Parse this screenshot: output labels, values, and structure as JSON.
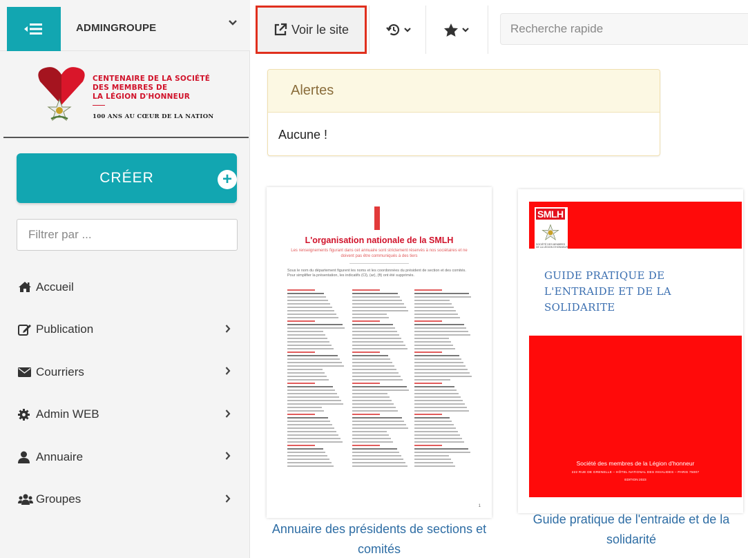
{
  "sidebar": {
    "group_name": "ADMINGROUPE",
    "logo": {
      "line1": "CENTENAIRE DE LA SOCIÉTÉ",
      "line2": "DES MEMBRES DE",
      "line3": "LA LÉGION D'HONNEUR",
      "tagline": "100 ANS AU CŒUR DE LA NATION"
    },
    "create_label": "CRÉER",
    "filter_placeholder": "Filtrer par ...",
    "items": [
      {
        "label": "Accueil",
        "icon": "home-icon",
        "has_submenu": false
      },
      {
        "label": "Publication",
        "icon": "edit-icon",
        "has_submenu": true
      },
      {
        "label": "Courriers",
        "icon": "envelope-icon",
        "has_submenu": true
      },
      {
        "label": "Admin WEB",
        "icon": "cog-icon",
        "has_submenu": true
      },
      {
        "label": "Annuaire",
        "icon": "user-icon",
        "has_submenu": true
      },
      {
        "label": "Groupes",
        "icon": "users-icon",
        "has_submenu": true
      }
    ]
  },
  "topbar": {
    "view_site_label": "Voir le site",
    "search_placeholder": "Recherche rapide"
  },
  "alerts": {
    "title": "Alertes",
    "body": "Aucune !"
  },
  "documents": [
    {
      "caption": "Annuaire des présidents de sections et comités",
      "cover_title": "L'organisation nationale de la SMLH",
      "cover_subtitle": "Les renseignements figurant dans cet annuaire sont strictement réservés à nos sociétaires et ne doivent pas être communiqués à des tiers",
      "cover_intro": "Sous le nom du département figurent les noms et les coordonnées du président de section et des comités. Pour simplifier la présentation, les indicatifs (Cl), (ar), (ft) ont été supprimés.",
      "page_number": "1"
    },
    {
      "caption": "Guide pratique de l'entraide et de la solidarité",
      "badge": "SMLH",
      "badge_small": "SOCIÉTÉ DES MEMBRES DE LA LÉGION D'HONNEUR",
      "cover_title_1": "GUIDE PRATIQUE DE",
      "cover_title_2": "L'ENTRAIDE ET DE LA",
      "cover_title_3": "SOLIDARITE",
      "footer_1": "Société des membres de la Légion d'honneur",
      "footer_2": "222 RUE DE GRENELLE – HÔTEL NATIONAL DES INVALIDES – PARIS 75007",
      "footer_3": "EDITION 2023"
    }
  ],
  "colors": {
    "accent": "#12a6b1",
    "highlight_border": "#e0301e",
    "link": "#2e6da4",
    "alert_bg": "#fcf8e3",
    "brand_red": "#d0122a"
  }
}
